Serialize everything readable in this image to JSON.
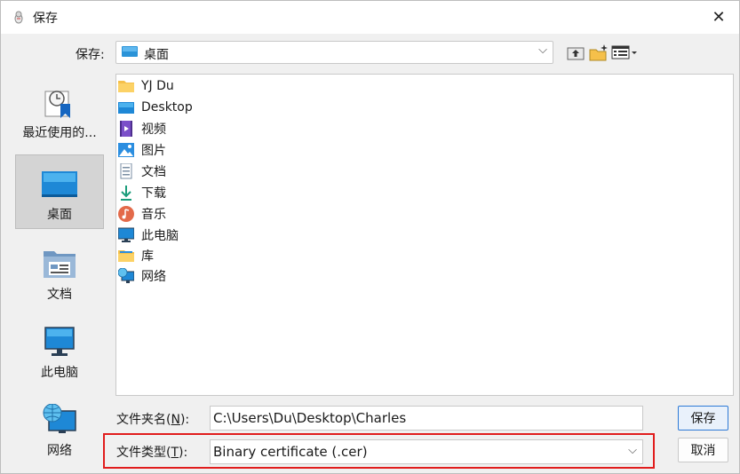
{
  "window": {
    "title": "保存",
    "close": "✕"
  },
  "save_in": {
    "label": "保存:",
    "location": "桌面",
    "toolbar": {
      "up": "up-folder-icon",
      "new_folder": "new-folder-icon",
      "view": "view-menu-icon"
    }
  },
  "places": [
    {
      "label": "最近使用的...",
      "icon": "recent-icon"
    },
    {
      "label": "桌面",
      "icon": "desktop-icon",
      "selected": true
    },
    {
      "label": "文档",
      "icon": "documents-icon"
    },
    {
      "label": "此电脑",
      "icon": "computer-icon"
    },
    {
      "label": "网络",
      "icon": "network-icon"
    }
  ],
  "files": [
    {
      "name": "YJ Du",
      "icon": "user-folder-icon"
    },
    {
      "name": "Desktop",
      "icon": "desktop-icon"
    },
    {
      "name": "视频",
      "icon": "video-icon"
    },
    {
      "name": "图片",
      "icon": "picture-icon"
    },
    {
      "name": "文档",
      "icon": "document-icon"
    },
    {
      "name": "下载",
      "icon": "download-icon"
    },
    {
      "name": "音乐",
      "icon": "music-icon"
    },
    {
      "name": "此电脑",
      "icon": "computer-icon"
    },
    {
      "name": "库",
      "icon": "library-icon"
    },
    {
      "name": "网络",
      "icon": "network-icon"
    }
  ],
  "file_name": {
    "label": "文件夹名",
    "accel": "(N)",
    "accel_key": "N",
    "colon": ":",
    "value": "C:\\Users\\Du\\Desktop\\Charles"
  },
  "file_type": {
    "label": "文件类型",
    "accel_key": "T",
    "colon": ":",
    "value": "Binary certificate (.cer)"
  },
  "buttons": {
    "save": "保存",
    "cancel": "取消"
  },
  "colors": {
    "highlight": "#e11d1d",
    "folder": "#f5c04a",
    "blue": "#1e88d6"
  }
}
